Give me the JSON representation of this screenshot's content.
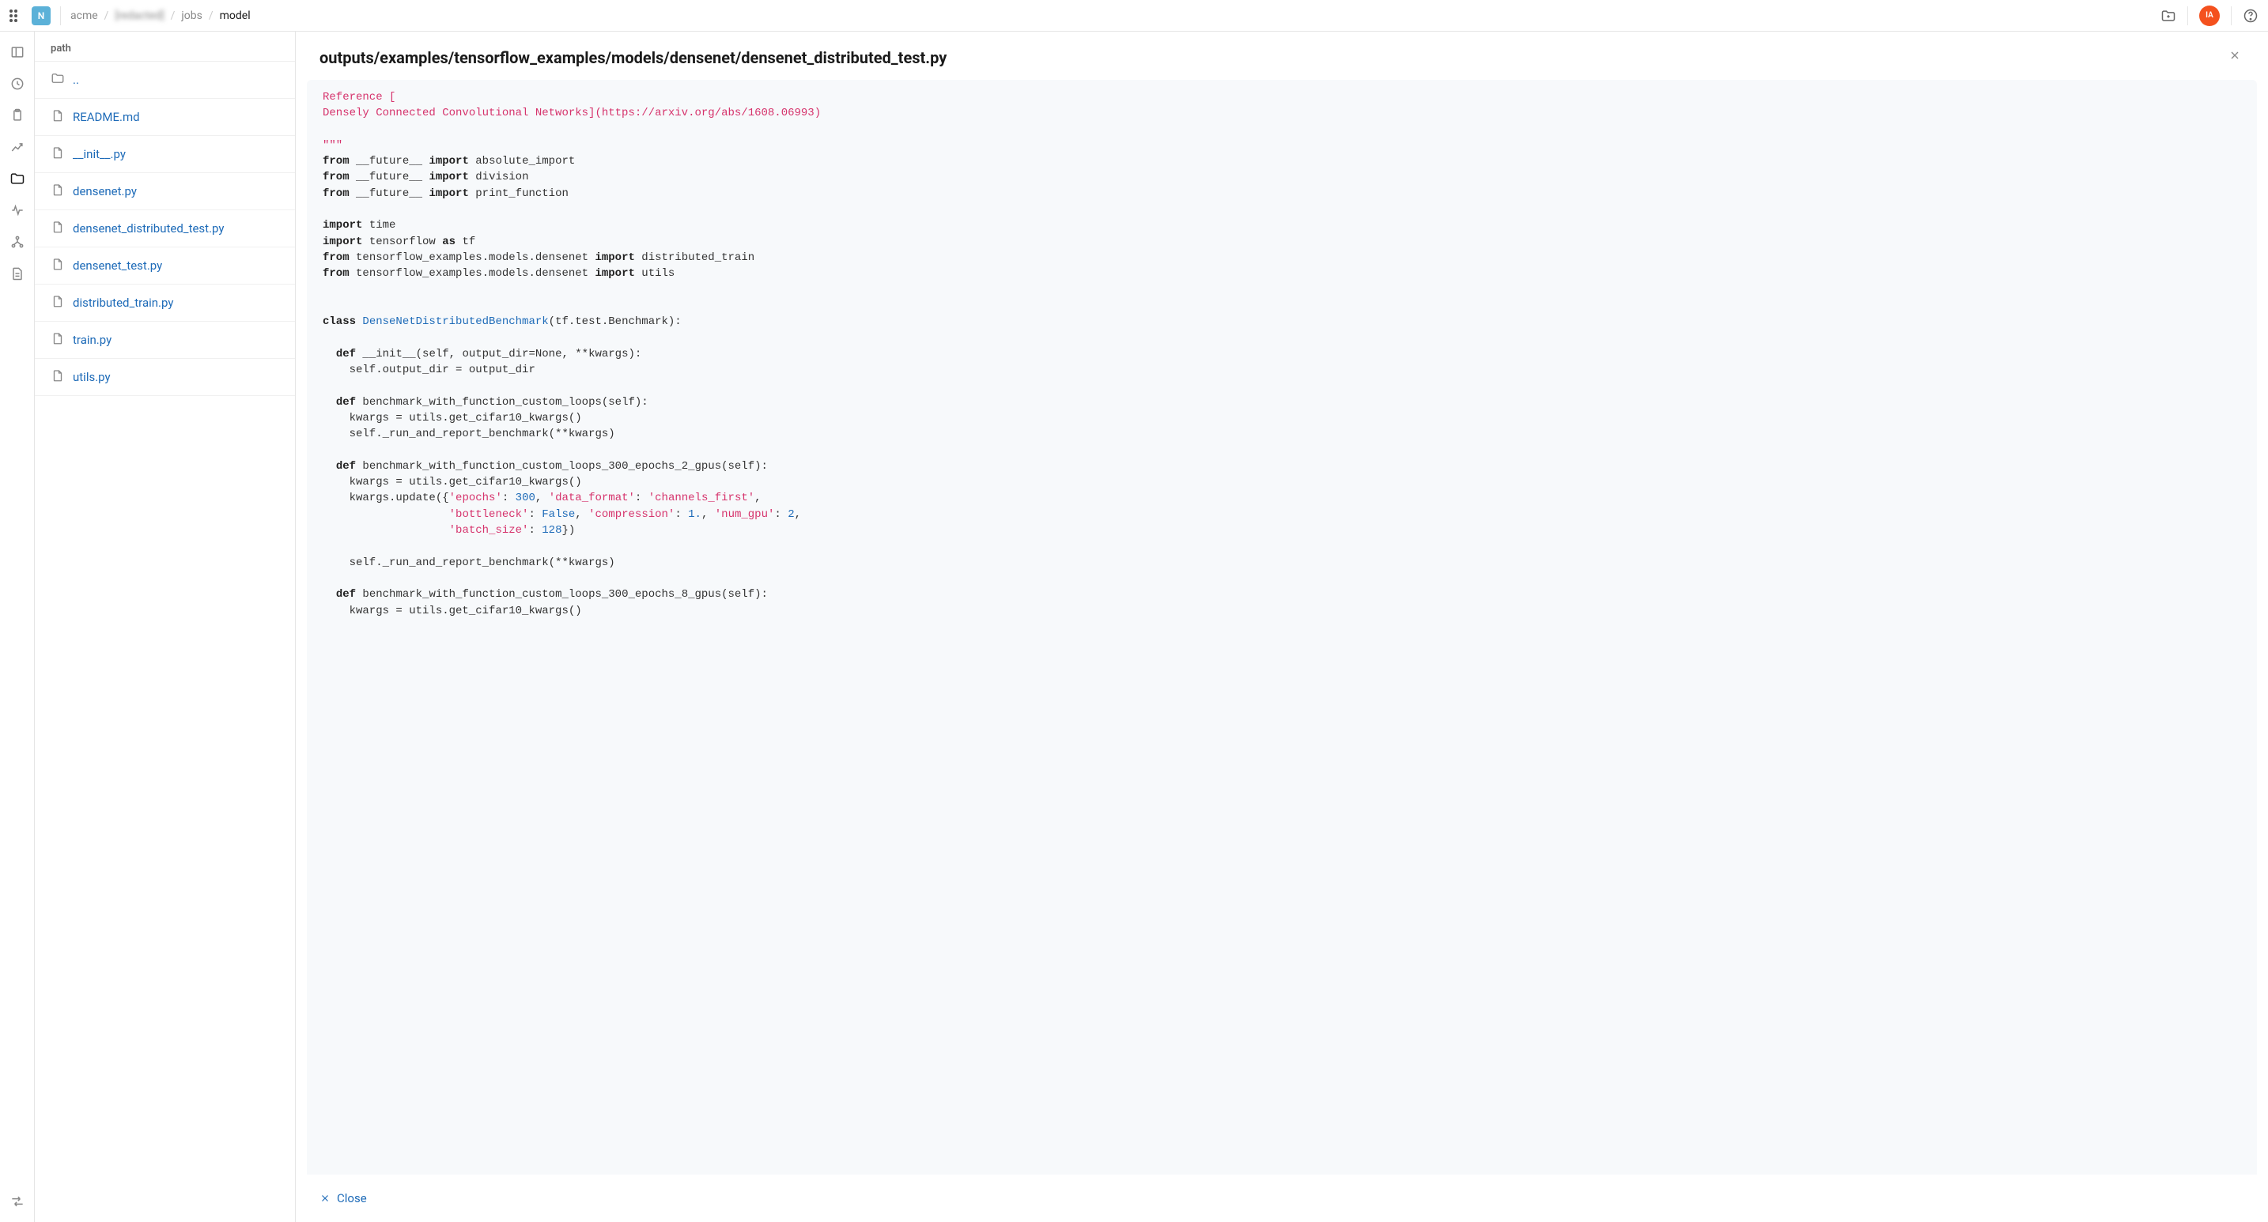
{
  "topbar": {
    "workspace_initial": "N",
    "breadcrumb": [
      "acme",
      "[redacted]",
      "jobs",
      "model"
    ],
    "avatar_initials": "IA"
  },
  "file_panel": {
    "header": "path",
    "items": [
      {
        "name": "..",
        "type": "folder"
      },
      {
        "name": "README.md",
        "type": "file"
      },
      {
        "name": "__init__.py",
        "type": "file"
      },
      {
        "name": "densenet.py",
        "type": "file"
      },
      {
        "name": "densenet_distributed_test.py",
        "type": "file"
      },
      {
        "name": "densenet_test.py",
        "type": "file"
      },
      {
        "name": "distributed_train.py",
        "type": "file"
      },
      {
        "name": "train.py",
        "type": "file"
      },
      {
        "name": "utils.py",
        "type": "file"
      }
    ]
  },
  "viewer": {
    "title": "outputs/examples/tensorflow_examples/models/densenet/densenet_distributed_test.py",
    "close_label": "Close",
    "code_tokens": [
      {
        "t": "Reference [",
        "c": "str"
      },
      {
        "t": "\n"
      },
      {
        "t": "Densely Connected Convolutional Networks](https://arxiv.org/abs/1608.06993)",
        "c": "str"
      },
      {
        "t": "\n"
      },
      {
        "t": "\n"
      },
      {
        "t": "\"\"\"",
        "c": "str"
      },
      {
        "t": "\n"
      },
      {
        "t": "from",
        "c": "kw"
      },
      {
        "t": " __future__ "
      },
      {
        "t": "import",
        "c": "kw"
      },
      {
        "t": " absolute_import\n"
      },
      {
        "t": "from",
        "c": "kw"
      },
      {
        "t": " __future__ "
      },
      {
        "t": "import",
        "c": "kw"
      },
      {
        "t": " division\n"
      },
      {
        "t": "from",
        "c": "kw"
      },
      {
        "t": " __future__ "
      },
      {
        "t": "import",
        "c": "kw"
      },
      {
        "t": " print_function\n"
      },
      {
        "t": "\n"
      },
      {
        "t": "import",
        "c": "kw"
      },
      {
        "t": " time\n"
      },
      {
        "t": "import",
        "c": "kw"
      },
      {
        "t": " tensorflow "
      },
      {
        "t": "as",
        "c": "kw"
      },
      {
        "t": " tf\n"
      },
      {
        "t": "from",
        "c": "kw"
      },
      {
        "t": " tensorflow_examples.models.densenet "
      },
      {
        "t": "import",
        "c": "kw"
      },
      {
        "t": " distributed_train\n"
      },
      {
        "t": "from",
        "c": "kw"
      },
      {
        "t": " tensorflow_examples.models.densenet "
      },
      {
        "t": "import",
        "c": "kw"
      },
      {
        "t": " utils\n"
      },
      {
        "t": "\n"
      },
      {
        "t": "\n"
      },
      {
        "t": "class",
        "c": "kw"
      },
      {
        "t": " "
      },
      {
        "t": "DenseNetDistributedBenchmark",
        "c": "cls"
      },
      {
        "t": "(tf.test.Benchmark):\n"
      },
      {
        "t": "\n"
      },
      {
        "t": "  "
      },
      {
        "t": "def",
        "c": "kw"
      },
      {
        "t": " __init__(self, output_dir=None, **kwargs):\n"
      },
      {
        "t": "    self.output_dir = output_dir\n"
      },
      {
        "t": "\n"
      },
      {
        "t": "  "
      },
      {
        "t": "def",
        "c": "kw"
      },
      {
        "t": " benchmark_with_function_custom_loops(self):\n"
      },
      {
        "t": "    kwargs = utils.get_cifar10_kwargs()\n"
      },
      {
        "t": "    self._run_and_report_benchmark(**kwargs)\n"
      },
      {
        "t": "\n"
      },
      {
        "t": "  "
      },
      {
        "t": "def",
        "c": "kw"
      },
      {
        "t": " benchmark_with_function_custom_loops_300_epochs_2_gpus(self):\n"
      },
      {
        "t": "    kwargs = utils.get_cifar10_kwargs()\n"
      },
      {
        "t": "    kwargs.update({"
      },
      {
        "t": "'epochs'",
        "c": "str"
      },
      {
        "t": ": "
      },
      {
        "t": "300",
        "c": "num"
      },
      {
        "t": ", "
      },
      {
        "t": "'data_format'",
        "c": "str"
      },
      {
        "t": ": "
      },
      {
        "t": "'channels_first'",
        "c": "str"
      },
      {
        "t": ",\n"
      },
      {
        "t": "                   "
      },
      {
        "t": "'bottleneck'",
        "c": "str"
      },
      {
        "t": ": "
      },
      {
        "t": "False",
        "c": "bool"
      },
      {
        "t": ", "
      },
      {
        "t": "'compression'",
        "c": "str"
      },
      {
        "t": ": "
      },
      {
        "t": "1.",
        "c": "num"
      },
      {
        "t": ", "
      },
      {
        "t": "'num_gpu'",
        "c": "str"
      },
      {
        "t": ": "
      },
      {
        "t": "2",
        "c": "num"
      },
      {
        "t": ",\n"
      },
      {
        "t": "                   "
      },
      {
        "t": "'batch_size'",
        "c": "str"
      },
      {
        "t": ": "
      },
      {
        "t": "128",
        "c": "num"
      },
      {
        "t": "})\n"
      },
      {
        "t": "\n"
      },
      {
        "t": "    self._run_and_report_benchmark(**kwargs)\n"
      },
      {
        "t": "\n"
      },
      {
        "t": "  "
      },
      {
        "t": "def",
        "c": "kw"
      },
      {
        "t": " benchmark_with_function_custom_loops_300_epochs_8_gpus(self):\n"
      },
      {
        "t": "    kwargs = utils.get_cifar10_kwargs()\n"
      }
    ]
  }
}
